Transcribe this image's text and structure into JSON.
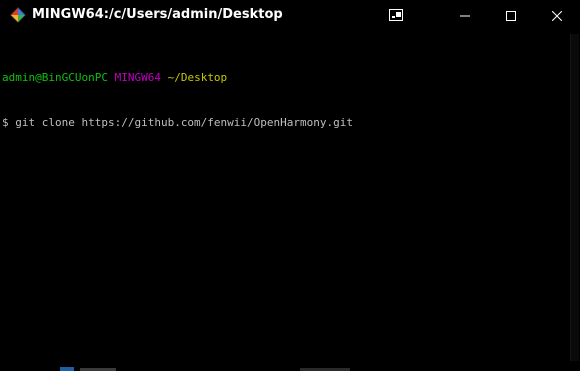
{
  "window": {
    "title": "MINGW64:/c/Users/admin/Desktop",
    "icon": "git-bash-icon",
    "controls": [
      "snap-layout-icon",
      "minimize-icon",
      "maximize-icon",
      "close-icon"
    ]
  },
  "terminal": {
    "prompt_user": "admin@BinGCUonPC",
    "prompt_system": "MINGW64",
    "prompt_path": "~/Desktop",
    "prompt_symbol": "$",
    "command": "git clone https://github.com/fenwii/OpenHarmony.git"
  },
  "colors": {
    "background": "#000000",
    "title_text": "#ffffff",
    "prompt_user": "#10c010",
    "prompt_system": "#c000c0",
    "prompt_path": "#c8c800",
    "command_text": "#bfbfbf"
  }
}
